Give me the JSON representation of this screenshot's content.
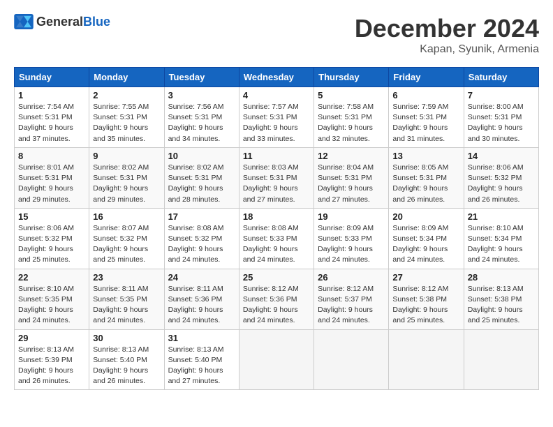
{
  "header": {
    "logo_general": "General",
    "logo_blue": "Blue",
    "month": "December 2024",
    "location": "Kapan, Syunik, Armenia"
  },
  "days_of_week": [
    "Sunday",
    "Monday",
    "Tuesday",
    "Wednesday",
    "Thursday",
    "Friday",
    "Saturday"
  ],
  "weeks": [
    [
      {
        "day": "1",
        "sunrise": "Sunrise: 7:54 AM",
        "sunset": "Sunset: 5:31 PM",
        "daylight": "Daylight: 9 hours and 37 minutes."
      },
      {
        "day": "2",
        "sunrise": "Sunrise: 7:55 AM",
        "sunset": "Sunset: 5:31 PM",
        "daylight": "Daylight: 9 hours and 35 minutes."
      },
      {
        "day": "3",
        "sunrise": "Sunrise: 7:56 AM",
        "sunset": "Sunset: 5:31 PM",
        "daylight": "Daylight: 9 hours and 34 minutes."
      },
      {
        "day": "4",
        "sunrise": "Sunrise: 7:57 AM",
        "sunset": "Sunset: 5:31 PM",
        "daylight": "Daylight: 9 hours and 33 minutes."
      },
      {
        "day": "5",
        "sunrise": "Sunrise: 7:58 AM",
        "sunset": "Sunset: 5:31 PM",
        "daylight": "Daylight: 9 hours and 32 minutes."
      },
      {
        "day": "6",
        "sunrise": "Sunrise: 7:59 AM",
        "sunset": "Sunset: 5:31 PM",
        "daylight": "Daylight: 9 hours and 31 minutes."
      },
      {
        "day": "7",
        "sunrise": "Sunrise: 8:00 AM",
        "sunset": "Sunset: 5:31 PM",
        "daylight": "Daylight: 9 hours and 30 minutes."
      }
    ],
    [
      {
        "day": "8",
        "sunrise": "Sunrise: 8:01 AM",
        "sunset": "Sunset: 5:31 PM",
        "daylight": "Daylight: 9 hours and 29 minutes."
      },
      {
        "day": "9",
        "sunrise": "Sunrise: 8:02 AM",
        "sunset": "Sunset: 5:31 PM",
        "daylight": "Daylight: 9 hours and 29 minutes."
      },
      {
        "day": "10",
        "sunrise": "Sunrise: 8:02 AM",
        "sunset": "Sunset: 5:31 PM",
        "daylight": "Daylight: 9 hours and 28 minutes."
      },
      {
        "day": "11",
        "sunrise": "Sunrise: 8:03 AM",
        "sunset": "Sunset: 5:31 PM",
        "daylight": "Daylight: 9 hours and 27 minutes."
      },
      {
        "day": "12",
        "sunrise": "Sunrise: 8:04 AM",
        "sunset": "Sunset: 5:31 PM",
        "daylight": "Daylight: 9 hours and 27 minutes."
      },
      {
        "day": "13",
        "sunrise": "Sunrise: 8:05 AM",
        "sunset": "Sunset: 5:31 PM",
        "daylight": "Daylight: 9 hours and 26 minutes."
      },
      {
        "day": "14",
        "sunrise": "Sunrise: 8:06 AM",
        "sunset": "Sunset: 5:32 PM",
        "daylight": "Daylight: 9 hours and 26 minutes."
      }
    ],
    [
      {
        "day": "15",
        "sunrise": "Sunrise: 8:06 AM",
        "sunset": "Sunset: 5:32 PM",
        "daylight": "Daylight: 9 hours and 25 minutes."
      },
      {
        "day": "16",
        "sunrise": "Sunrise: 8:07 AM",
        "sunset": "Sunset: 5:32 PM",
        "daylight": "Daylight: 9 hours and 25 minutes."
      },
      {
        "day": "17",
        "sunrise": "Sunrise: 8:08 AM",
        "sunset": "Sunset: 5:32 PM",
        "daylight": "Daylight: 9 hours and 24 minutes."
      },
      {
        "day": "18",
        "sunrise": "Sunrise: 8:08 AM",
        "sunset": "Sunset: 5:33 PM",
        "daylight": "Daylight: 9 hours and 24 minutes."
      },
      {
        "day": "19",
        "sunrise": "Sunrise: 8:09 AM",
        "sunset": "Sunset: 5:33 PM",
        "daylight": "Daylight: 9 hours and 24 minutes."
      },
      {
        "day": "20",
        "sunrise": "Sunrise: 8:09 AM",
        "sunset": "Sunset: 5:34 PM",
        "daylight": "Daylight: 9 hours and 24 minutes."
      },
      {
        "day": "21",
        "sunrise": "Sunrise: 8:10 AM",
        "sunset": "Sunset: 5:34 PM",
        "daylight": "Daylight: 9 hours and 24 minutes."
      }
    ],
    [
      {
        "day": "22",
        "sunrise": "Sunrise: 8:10 AM",
        "sunset": "Sunset: 5:35 PM",
        "daylight": "Daylight: 9 hours and 24 minutes."
      },
      {
        "day": "23",
        "sunrise": "Sunrise: 8:11 AM",
        "sunset": "Sunset: 5:35 PM",
        "daylight": "Daylight: 9 hours and 24 minutes."
      },
      {
        "day": "24",
        "sunrise": "Sunrise: 8:11 AM",
        "sunset": "Sunset: 5:36 PM",
        "daylight": "Daylight: 9 hours and 24 minutes."
      },
      {
        "day": "25",
        "sunrise": "Sunrise: 8:12 AM",
        "sunset": "Sunset: 5:36 PM",
        "daylight": "Daylight: 9 hours and 24 minutes."
      },
      {
        "day": "26",
        "sunrise": "Sunrise: 8:12 AM",
        "sunset": "Sunset: 5:37 PM",
        "daylight": "Daylight: 9 hours and 24 minutes."
      },
      {
        "day": "27",
        "sunrise": "Sunrise: 8:12 AM",
        "sunset": "Sunset: 5:38 PM",
        "daylight": "Daylight: 9 hours and 25 minutes."
      },
      {
        "day": "28",
        "sunrise": "Sunrise: 8:13 AM",
        "sunset": "Sunset: 5:38 PM",
        "daylight": "Daylight: 9 hours and 25 minutes."
      }
    ],
    [
      {
        "day": "29",
        "sunrise": "Sunrise: 8:13 AM",
        "sunset": "Sunset: 5:39 PM",
        "daylight": "Daylight: 9 hours and 26 minutes."
      },
      {
        "day": "30",
        "sunrise": "Sunrise: 8:13 AM",
        "sunset": "Sunset: 5:40 PM",
        "daylight": "Daylight: 9 hours and 26 minutes."
      },
      {
        "day": "31",
        "sunrise": "Sunrise: 8:13 AM",
        "sunset": "Sunset: 5:40 PM",
        "daylight": "Daylight: 9 hours and 27 minutes."
      },
      null,
      null,
      null,
      null
    ]
  ]
}
